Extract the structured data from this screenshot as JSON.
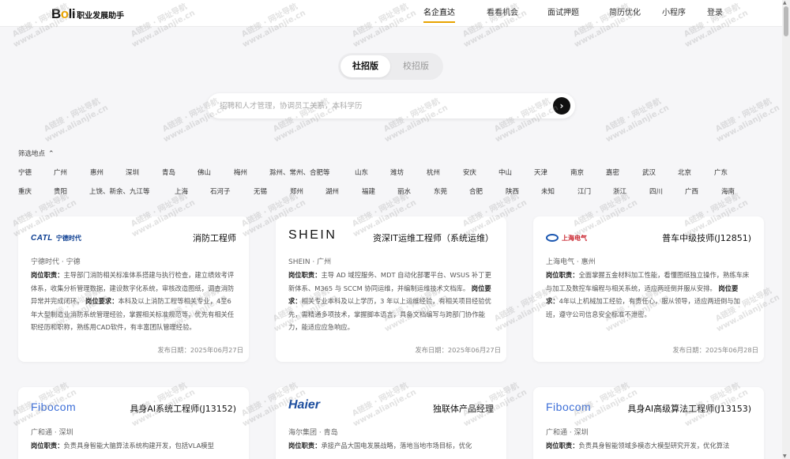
{
  "header": {
    "logo_mark_a": "B",
    "logo_mark_b": "o",
    "logo_mark_c": "li",
    "logo_sub": "职业发展助手",
    "nav": [
      "名企直达",
      "看看机会",
      "面试押题",
      "简历优化",
      "小程序",
      "登录"
    ],
    "active_nav": "名企直达"
  },
  "toggle": {
    "social": "社招版",
    "campus": "校招版",
    "selected": "社招版"
  },
  "search": {
    "placeholder": "招聘和人才管理，协调员工关系，本科学历",
    "button_icon": "arrow-right-icon"
  },
  "filter": {
    "title": "筛选地点",
    "rows": [
      [
        "宁德",
        "广州",
        "惠州",
        "深圳",
        "青岛",
        "佛山",
        "梅州",
        "滁州、常州、合肥等",
        "山东",
        "潍坊",
        "杭州",
        "安庆",
        "中山",
        "天津",
        "南京",
        "嘉密",
        "武汉",
        "北京",
        "广东"
      ],
      [
        "重庆",
        "贵阳",
        "上饶、新余、九江等",
        "上海",
        "石河子",
        "无锡",
        "郑州",
        "湖州",
        "福建",
        "丽水",
        "东莞",
        "合肥",
        "陕西",
        "未知",
        "江门",
        "浙江",
        "四川",
        "广西",
        "海南"
      ]
    ]
  },
  "cards": [
    {
      "logo_text": "CATL",
      "logo_cn": "宁德时代",
      "title": "消防工程师",
      "company": "宁德时代 · 宁德",
      "duty_label": "岗位职责：",
      "duty": "主导部门消防相关标准体系搭建与执行检查，建立绩效考评体系，收集分析管理数据，建设数字化系统，审核改造图纸，调查消防异常并完成闭环。",
      "req_label": "岗位要求：",
      "req": "本科及以上消防工程等相关专业，4至6年大型制造业消防系统管理经验，掌握相关标准规范等，优先有相关任职经历和职称，熟练用CAD软件，有丰富团队管理经验。",
      "date": "发布日期：2025年06月27日"
    },
    {
      "logo_text": "SHEIN",
      "title": "资深IT运维工程师（系统运维）",
      "company": "SHEIN · 广州",
      "duty_label": "岗位职责：",
      "duty": "主导 AD 域控服务、MDT 自动化部署平台、WSUS 补丁更新体系、M365 与 SCCM 协同运维，并编制运维技术文档库。",
      "req_label": "岗位要求：",
      "req": "相关专业本科及以上学历，3 年以上运维经验，有相关项目经验优先，需精通多项技术，掌握脚本语言，具备文档编写与跨部门协作能力，能适应应急响应。",
      "date": "发布日期：2025年06月27日"
    },
    {
      "logo_text": "上海电气",
      "title": "普车中级技师(J12851)",
      "company": "上海电气 · 惠州",
      "duty_label": "岗位职责：",
      "duty": "全面掌握五金材料加工性能，看懂图纸独立操作，熟练车床与加工及数控车编程与相关系统，适应两班倒并服从安排。",
      "req_label": "岗位要求：",
      "req": "4年以上机械加工经验，有责任心，服从领导，适应两班倒与加班，遵守公司信息安全标准不泄密。",
      "date": "发布日期：2025年06月28日"
    },
    {
      "logo_text": "Fibocom",
      "title": "具身AI系统工程师(J13152)",
      "company": "广和通 · 深圳",
      "duty_label": "岗位职责：",
      "duty": "负责具身智能大脑算法系统构建开发，包括VLA模型",
      "date": ""
    },
    {
      "logo_text": "Haier",
      "title": "独联体产品经理",
      "company": "海尔集团 · 青岛",
      "duty_label": "岗位职责：",
      "duty": "承接产品大国电发展战略，落地当地市场目标，优化",
      "date": ""
    },
    {
      "logo_text": "Fibocom",
      "title": "具身AI高级算法工程师(J13153)",
      "company": "广和通 · 深圳",
      "duty_label": "岗位职责：",
      "duty": "负责具身智能领域多模态大模型研究开发，优化算法",
      "date": ""
    }
  ],
  "watermark": {
    "line1": "A链接 · 网址导航",
    "line2": "www.alianjie.cn"
  }
}
